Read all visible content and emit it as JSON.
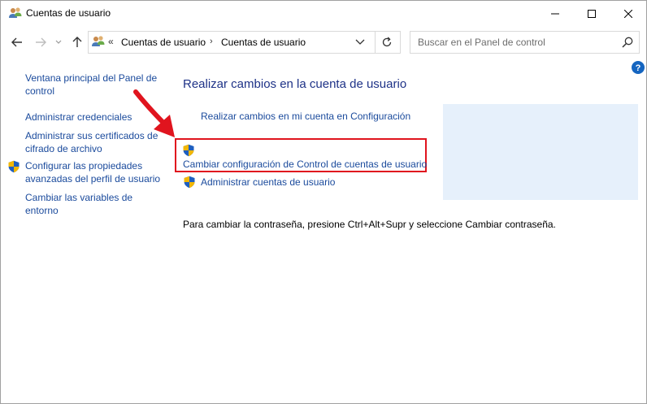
{
  "window": {
    "title": "Cuentas de usuario",
    "icon": "users-icon"
  },
  "controls": {
    "minimize_icon": "minimize-icon",
    "maximize_icon": "maximize-icon",
    "close_icon": "close-icon"
  },
  "nav": {
    "breadcrumb_overflow": "«",
    "breadcrumbs": [
      "Cuentas de usuario",
      "Cuentas de usuario"
    ],
    "separator": "›"
  },
  "search": {
    "placeholder": "Buscar en el Panel de control"
  },
  "sidebar": {
    "items": [
      {
        "label": "Ventana principal del Panel de control",
        "shield": false
      },
      {
        "label": "Administrar credenciales",
        "shield": false
      },
      {
        "label": "Administrar sus certificados de cifrado de archivo",
        "shield": false
      },
      {
        "label": "Configurar las propiedades avanzadas del perfil de usuario",
        "shield": true
      },
      {
        "label": "Cambiar las variables de entorno",
        "shield": false
      }
    ]
  },
  "main": {
    "heading": "Realizar cambios en la cuenta de usuario",
    "links": {
      "config": "Realizar cambios en mi cuenta en Configuración",
      "uac": "Cambiar configuración de Control de cuentas de usuario",
      "manage": "Administrar cuentas de usuario"
    },
    "password_hint": "Para cambiar la contraseña, presione Ctrl+Alt+Supr y seleccione Cambiar contraseña."
  },
  "colors": {
    "link": "#1a4a9c",
    "heading": "#1e3287",
    "highlight": "#e0141e",
    "picture_panel": "#e6f0fb"
  }
}
